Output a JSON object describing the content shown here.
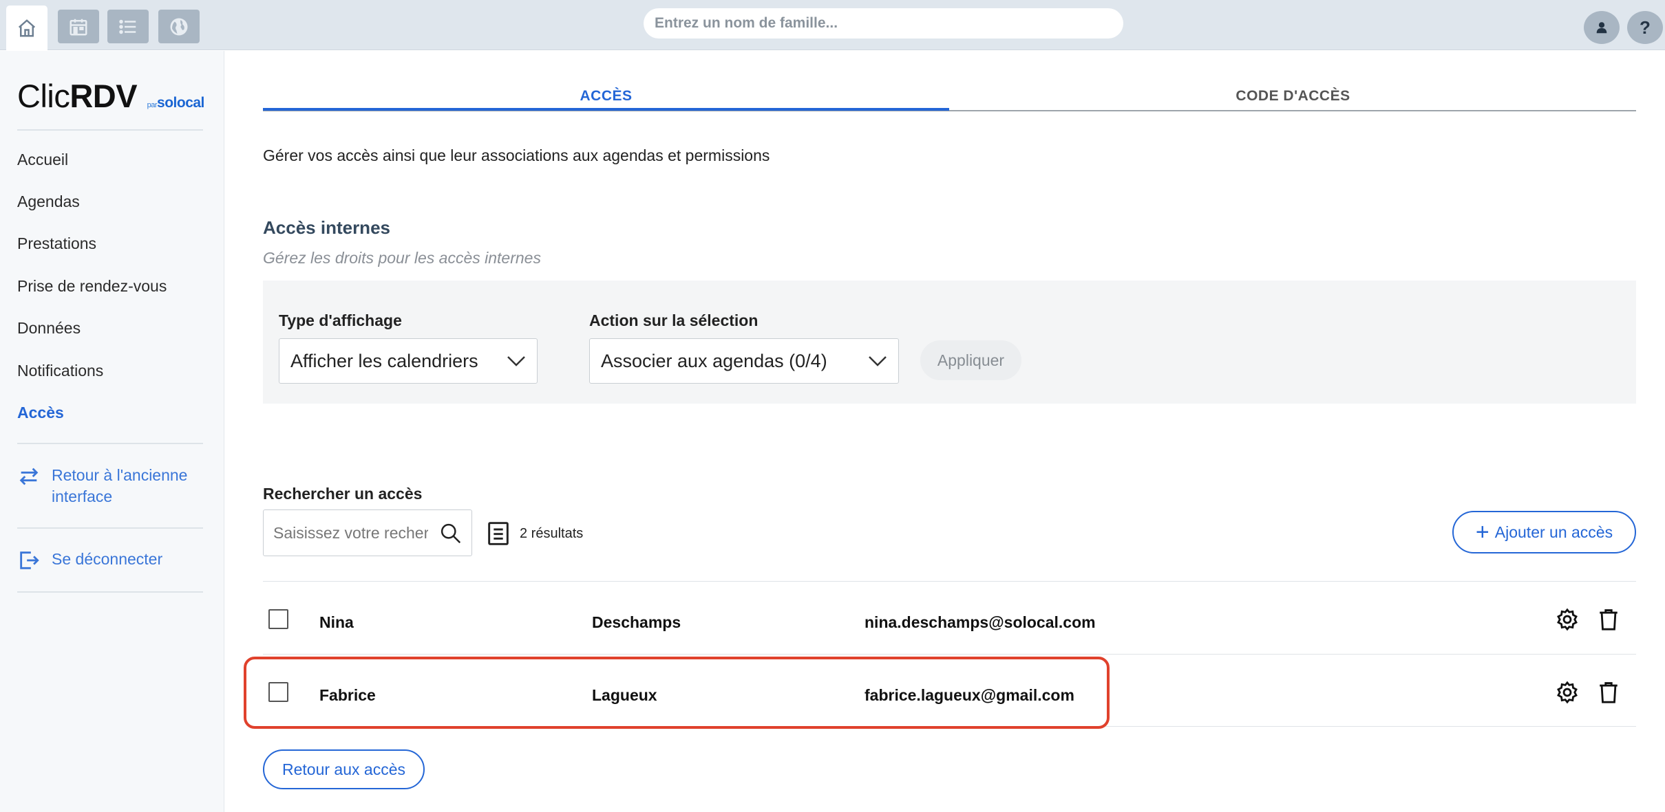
{
  "topbar": {
    "search_placeholder": "Entrez un nom de famille...",
    "help_label": "?"
  },
  "sidebar": {
    "logo": {
      "clic": "Clic",
      "rdv": "RDV",
      "par": "par",
      "solocal": "solocal"
    },
    "items": [
      {
        "label": "Accueil"
      },
      {
        "label": "Agendas"
      },
      {
        "label": "Prestations"
      },
      {
        "label": "Prise de rendez-vous"
      },
      {
        "label": "Données"
      },
      {
        "label": "Notifications"
      },
      {
        "label": "Accès"
      }
    ],
    "back_old_interface_line1": "Retour à l'ancienne",
    "back_old_interface_line2": "interface",
    "logout": "Se déconnecter"
  },
  "tabs": [
    {
      "label": "ACCÈS"
    },
    {
      "label": "CODE D'ACCÈS"
    }
  ],
  "description": "Gérer vos accès ainsi que leur associations aux agendas et permissions",
  "section": {
    "title": "Accès internes",
    "subtitle": "Gérez les droits pour les accès internes"
  },
  "filters": {
    "display_type_label": "Type d'affichage",
    "display_type_value": "Afficher les calendriers",
    "action_label": "Action sur la sélection",
    "action_value": "Associer aux agendas (0/4)",
    "apply_label": "Appliquer"
  },
  "search": {
    "label": "Rechercher un accès",
    "placeholder": "Saisissez votre recherche",
    "results": "2 résultats"
  },
  "add_button": "Ajouter un accès",
  "rows": [
    {
      "first_name": "Nina",
      "last_name": "Deschamps",
      "email": "nina.deschamps@solocal.com"
    },
    {
      "first_name": "Fabrice",
      "last_name": "Lagueux",
      "email": "fabrice.lagueux@gmail.com"
    }
  ],
  "back_button": "Retour aux accès",
  "colors": {
    "accent": "#2466d6",
    "highlight": "#e0412c",
    "topbar": "#dfe6ed"
  }
}
